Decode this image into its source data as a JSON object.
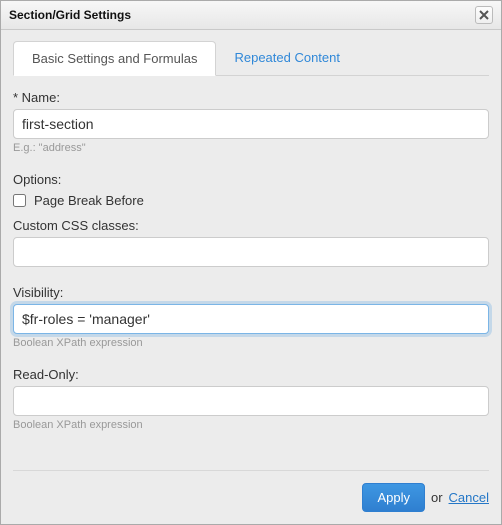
{
  "dialog": {
    "title": "Section/Grid Settings"
  },
  "tabs": {
    "basic": "Basic Settings and Formulas",
    "repeated": "Repeated Content"
  },
  "fields": {
    "name": {
      "label": "Name:",
      "value": "first-section",
      "hint": "E.g.: \"address\""
    },
    "options": {
      "label": "Options:",
      "page_break_label": "Page Break Before",
      "page_break_checked": false
    },
    "css": {
      "label": "Custom CSS classes:",
      "value": ""
    },
    "visibility": {
      "label": "Visibility:",
      "value": "$fr-roles = 'manager'",
      "hint": "Boolean XPath expression"
    },
    "readonly": {
      "label": "Read-Only:",
      "value": "",
      "hint": "Boolean XPath expression"
    }
  },
  "footer": {
    "apply": "Apply",
    "or": "or",
    "cancel": "Cancel"
  }
}
